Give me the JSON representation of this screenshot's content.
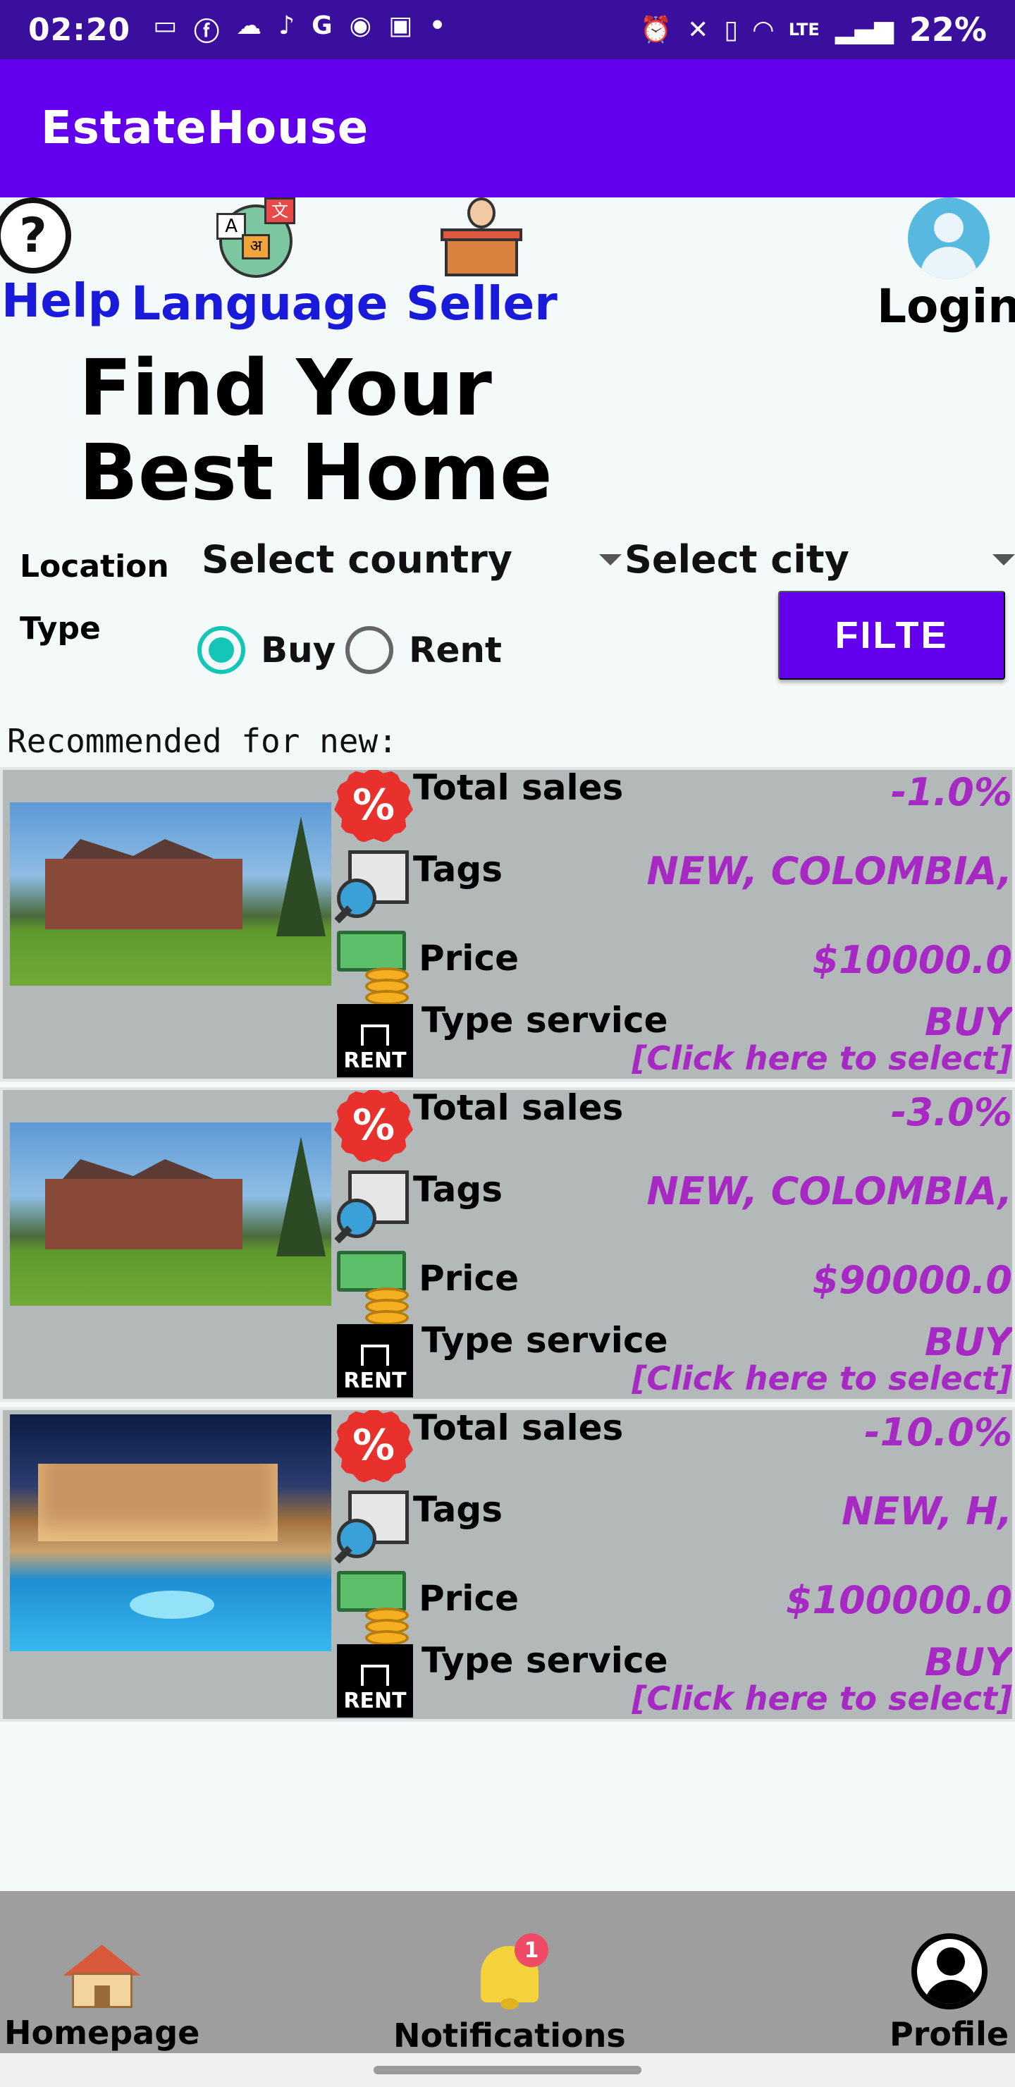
{
  "status_bar": {
    "time": "02:20",
    "battery": "22%",
    "network": "LTE",
    "left_icons": [
      "camera-icon",
      "facebook-icon",
      "cloud-icon",
      "tiktok-icon",
      "google-icon",
      "wifi-calling-icon",
      "app-icon"
    ],
    "right_icons": [
      "alarm-icon",
      "mute-icon",
      "nfc-icon",
      "wifi-icon",
      "signal-icon"
    ]
  },
  "app_bar": {
    "title": "EstateHouse"
  },
  "top_actions": {
    "help": "Help",
    "language": "Language",
    "seller": "Seller",
    "login": "Login"
  },
  "hero": {
    "title": "Find Your Best Home"
  },
  "filters": {
    "location_label": "Location",
    "type_label": "Type",
    "country_dropdown": "Select country",
    "city_dropdown": "Select city",
    "radio_buy": "Buy",
    "radio_rent": "Rent",
    "selected_type": "Buy",
    "filter_button": "FILTE"
  },
  "section": {
    "recommended_label": "Recommended for new:"
  },
  "labels": {
    "total_sales": "Total sales",
    "tags": "Tags",
    "price": "Price",
    "type_service": "Type service",
    "select_hint": "[Click here to select]"
  },
  "listings": [
    {
      "total_sales": "-1.0%",
      "tags": "NEW, COLOMBIA,",
      "price": "$10000.0",
      "type_service": "BUY"
    },
    {
      "total_sales": "-3.0%",
      "tags": "NEW, COLOMBIA,",
      "price": "$90000.0",
      "type_service": "BUY"
    },
    {
      "total_sales": "-10.0%",
      "tags": "NEW, H,",
      "price": "$100000.0",
      "type_service": "BUY"
    }
  ],
  "bottom_nav": {
    "home": "Homepage",
    "notifications": "Notifications",
    "notifications_badge": "1",
    "profile": "Profile"
  },
  "colors": {
    "status_bar": "#3a0f9e",
    "primary": "#6200ee",
    "link_blue": "#1a1adb",
    "value_purple": "#a629c3",
    "radio_teal": "#13c6b8",
    "card_bg": "#b3b8b8",
    "nav_bg": "#9e9e9e"
  }
}
